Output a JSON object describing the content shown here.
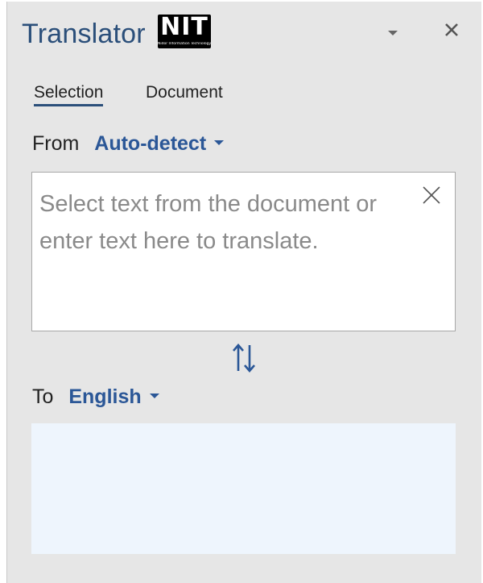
{
  "header": {
    "title": "Translator",
    "logo": {
      "word": "NIT",
      "tagline": "Nidor Information Technology"
    },
    "icons": {
      "menu": "chevron-down-icon",
      "close": "close-icon"
    }
  },
  "tabs": [
    {
      "label": "Selection",
      "active": true
    },
    {
      "label": "Document",
      "active": false
    }
  ],
  "from": {
    "label": "From",
    "language": "Auto-detect"
  },
  "source": {
    "value": "",
    "placeholder": "Select text from the document or enter text here to translate."
  },
  "to": {
    "label": "To",
    "language": "English"
  },
  "target": {
    "text": ""
  },
  "colors": {
    "accent": "#2b5797",
    "title": "#2b4f7a",
    "pane_background": "#e6e6e6",
    "target_background": "#eef5fd"
  }
}
